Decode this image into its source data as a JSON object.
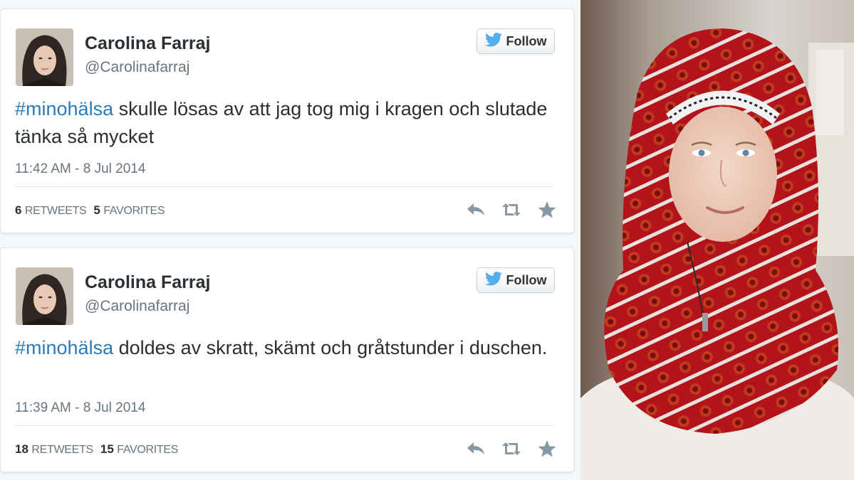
{
  "tweets": [
    {
      "name": "Carolina Farraj",
      "handle": "@Carolinafarraj",
      "follow_label": "Follow",
      "hashtag": "#minohälsa",
      "text": " skulle lösas av att jag tog mig i kragen och slutade tänka så mycket",
      "timestamp": "11:42 AM - 8 Jul 2014",
      "retweets_count": "6",
      "retweets_label": "RETWEETS",
      "favorites_count": "5",
      "favorites_label": "FAVORITES"
    },
    {
      "name": "Carolina Farraj",
      "handle": "@Carolinafarraj",
      "follow_label": "Follow",
      "hashtag": "#minohälsa",
      "text": " doldes av skratt, skämt och gråtstunder i duschen.",
      "timestamp": "11:39 AM - 8 Jul 2014",
      "retweets_count": "18",
      "retweets_label": "RETWEETS",
      "favorites_count": "15",
      "favorites_label": "FAVORITES"
    }
  ],
  "icons": {
    "follow": "twitter-bird-icon",
    "reply": "reply-icon",
    "retweet": "retweet-icon",
    "favorite": "star-icon"
  },
  "colors": {
    "hashtag": "#2b7bb9",
    "twitter_blue": "#55acee",
    "muted": "#66757f",
    "action_icon": "#8899a6"
  }
}
